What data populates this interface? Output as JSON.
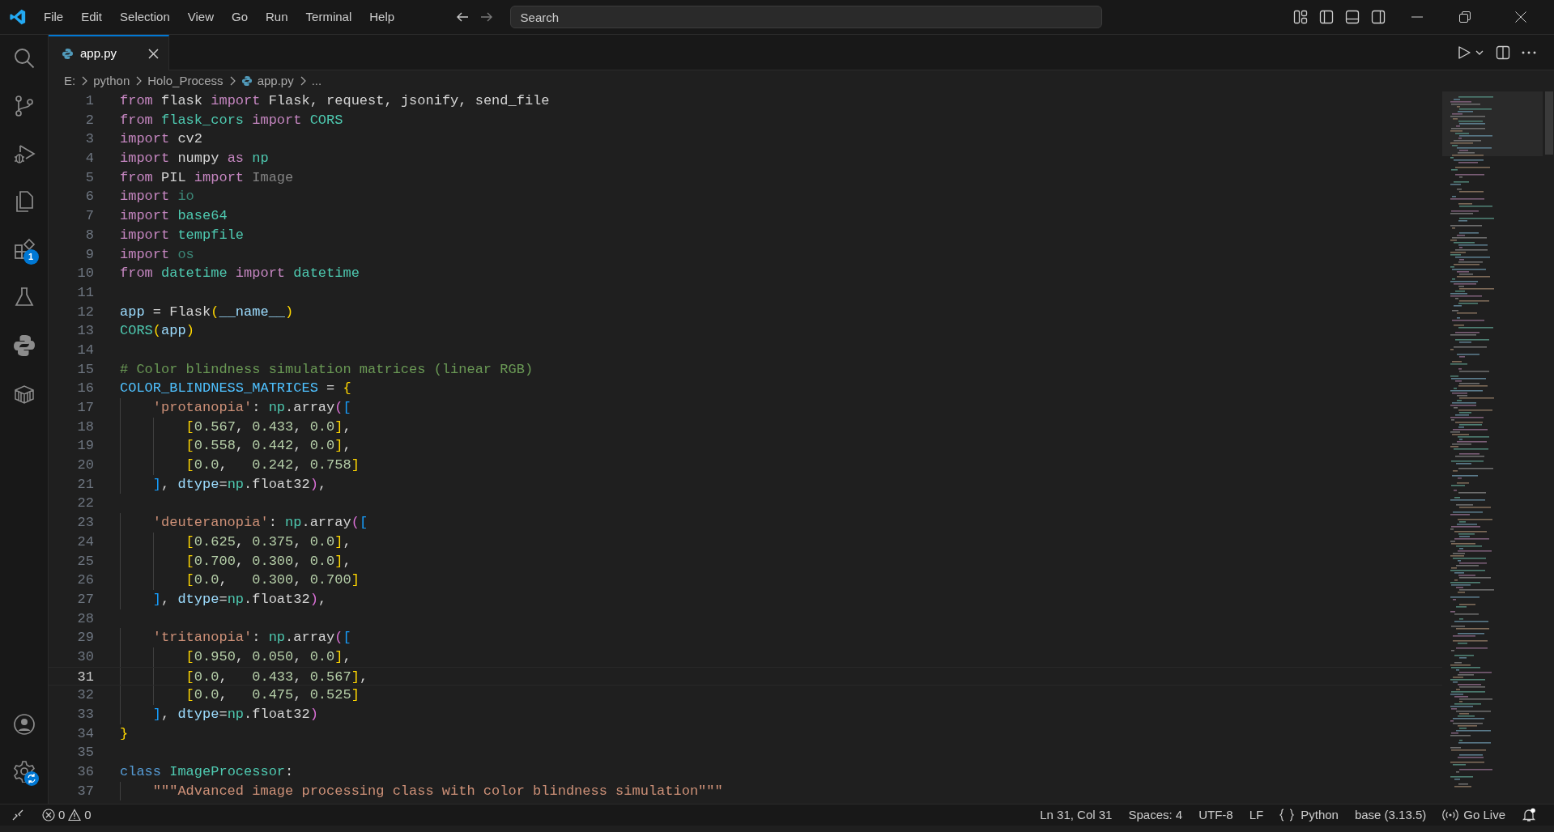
{
  "title_bar": {
    "menu": [
      "File",
      "Edit",
      "Selection",
      "View",
      "Go",
      "Run",
      "Terminal",
      "Help"
    ],
    "search": {
      "placeholder": "Search"
    }
  },
  "activity_bar": {
    "extensions_badge": "1"
  },
  "tabs": [
    {
      "label": "app.py",
      "selected": true
    }
  ],
  "breadcrumbs": [
    {
      "label": "E:",
      "kind": "folder"
    },
    {
      "label": "python",
      "kind": "folder"
    },
    {
      "label": "Holo_Process",
      "kind": "folder"
    },
    {
      "label": "app.py",
      "kind": "file"
    },
    {
      "label": "...",
      "kind": "more"
    }
  ],
  "editor": {
    "lines": [
      {
        "number": "1",
        "current": false,
        "tokens": [
          {
            "text": "from",
            "kind": "kw"
          },
          {
            "text": " flask ",
            "kind": "p"
          },
          {
            "text": "import",
            "kind": "kw"
          },
          {
            "text": " Flask, request, jsonify, send_file",
            "kind": "p"
          }
        ]
      },
      {
        "number": "2",
        "current": false,
        "tokens": [
          {
            "text": "from",
            "kind": "kw"
          },
          {
            "text": " flask_cors ",
            "kind": "mod"
          },
          {
            "text": "import",
            "kind": "kw"
          },
          {
            "text": " CORS",
            "kind": "mod"
          }
        ]
      },
      {
        "number": "3",
        "current": false,
        "tokens": [
          {
            "text": "import",
            "kind": "kw"
          },
          {
            "text": " cv2",
            "kind": "p"
          }
        ]
      },
      {
        "number": "4",
        "current": false,
        "tokens": [
          {
            "text": "import",
            "kind": "kw"
          },
          {
            "text": " numpy ",
            "kind": "p"
          },
          {
            "text": "as",
            "kind": "kw"
          },
          {
            "text": " np",
            "kind": "mod"
          }
        ]
      },
      {
        "number": "5",
        "current": false,
        "tokens": [
          {
            "text": "from",
            "kind": "kw"
          },
          {
            "text": " PIL ",
            "kind": "p"
          },
          {
            "text": "import",
            "kind": "kw"
          },
          {
            "text": " Image",
            "kind": "unused"
          }
        ]
      },
      {
        "number": "6",
        "current": false,
        "tokens": [
          {
            "text": "import",
            "kind": "kw"
          },
          {
            "text": " io",
            "kind": "unusedmod"
          }
        ]
      },
      {
        "number": "7",
        "current": false,
        "tokens": [
          {
            "text": "import",
            "kind": "kw"
          },
          {
            "text": " base64",
            "kind": "mod"
          }
        ]
      },
      {
        "number": "8",
        "current": false,
        "tokens": [
          {
            "text": "import",
            "kind": "kw"
          },
          {
            "text": " tempfile",
            "kind": "mod"
          }
        ]
      },
      {
        "number": "9",
        "current": false,
        "tokens": [
          {
            "text": "import",
            "kind": "kw"
          },
          {
            "text": " os",
            "kind": "unusedmod"
          }
        ]
      },
      {
        "number": "10",
        "current": false,
        "tokens": [
          {
            "text": "from",
            "kind": "kw"
          },
          {
            "text": " datetime ",
            "kind": "mod"
          },
          {
            "text": "import",
            "kind": "kw"
          },
          {
            "text": " datetime",
            "kind": "mod"
          }
        ]
      },
      {
        "number": "11",
        "current": false
      },
      {
        "number": "12",
        "current": false,
        "tokens": [
          {
            "text": "app",
            "kind": "var"
          },
          {
            "text": " = Flask",
            "kind": "p"
          },
          {
            "text": "(",
            "kind": "b1"
          },
          {
            "text": "__name__",
            "kind": "var"
          },
          {
            "text": ")",
            "kind": "b1"
          }
        ]
      },
      {
        "number": "13",
        "current": false,
        "tokens": [
          {
            "text": "CORS",
            "kind": "mod"
          },
          {
            "text": "(",
            "kind": "b1"
          },
          {
            "text": "app",
            "kind": "var"
          },
          {
            "text": ")",
            "kind": "b1"
          }
        ]
      },
      {
        "number": "14",
        "current": false
      },
      {
        "number": "15",
        "current": false,
        "tokens": [
          {
            "text": "# Color blindness simulation matrices (linear RGB)",
            "kind": "com"
          }
        ]
      },
      {
        "number": "16",
        "current": false,
        "tokens": [
          {
            "text": "COLOR_BLINDNESS_MATRICES",
            "kind": "const"
          },
          {
            "text": " = ",
            "kind": "p"
          },
          {
            "text": "{",
            "kind": "b1"
          }
        ]
      },
      {
        "number": "17",
        "current": false,
        "tokens": [
          {
            "text": "    'protanopia'",
            "kind": "str"
          },
          {
            "text": ": ",
            "kind": "p"
          },
          {
            "text": "np",
            "kind": "mod"
          },
          {
            "text": ".array",
            "kind": "p"
          },
          {
            "text": "(",
            "kind": "b2"
          },
          {
            "text": "[",
            "kind": "b3"
          }
        ]
      },
      {
        "number": "18",
        "current": false,
        "tokens": [
          {
            "text": "        [",
            "kind": "b1"
          },
          {
            "text": "0.567",
            "kind": "num"
          },
          {
            "text": ", ",
            "kind": "p"
          },
          {
            "text": "0.433",
            "kind": "num"
          },
          {
            "text": ", ",
            "kind": "p"
          },
          {
            "text": "0.0",
            "kind": "num"
          },
          {
            "text": "]",
            "kind": "b1"
          },
          {
            "text": ",",
            "kind": "p"
          }
        ]
      },
      {
        "number": "19",
        "current": false,
        "tokens": [
          {
            "text": "        [",
            "kind": "b1"
          },
          {
            "text": "0.558",
            "kind": "num"
          },
          {
            "text": ", ",
            "kind": "p"
          },
          {
            "text": "0.442",
            "kind": "num"
          },
          {
            "text": ", ",
            "kind": "p"
          },
          {
            "text": "0.0",
            "kind": "num"
          },
          {
            "text": "]",
            "kind": "b1"
          },
          {
            "text": ",",
            "kind": "p"
          }
        ]
      },
      {
        "number": "20",
        "current": false,
        "tokens": [
          {
            "text": "        [",
            "kind": "b1"
          },
          {
            "text": "0.0",
            "kind": "num"
          },
          {
            "text": ",   ",
            "kind": "p"
          },
          {
            "text": "0.242",
            "kind": "num"
          },
          {
            "text": ", ",
            "kind": "p"
          },
          {
            "text": "0.758",
            "kind": "num"
          },
          {
            "text": "]",
            "kind": "b1"
          }
        ]
      },
      {
        "number": "21",
        "current": false,
        "tokens": [
          {
            "text": "    ]",
            "kind": "b3"
          },
          {
            "text": ", ",
            "kind": "p"
          },
          {
            "text": "dtype",
            "kind": "var"
          },
          {
            "text": "=",
            "kind": "p"
          },
          {
            "text": "np",
            "kind": "mod"
          },
          {
            "text": ".float32",
            "kind": "p"
          },
          {
            "text": ")",
            "kind": "b2"
          },
          {
            "text": ",",
            "kind": "p"
          }
        ]
      },
      {
        "number": "22",
        "current": false
      },
      {
        "number": "23",
        "current": false,
        "tokens": [
          {
            "text": "    'deuteranopia'",
            "kind": "str"
          },
          {
            "text": ": ",
            "kind": "p"
          },
          {
            "text": "np",
            "kind": "mod"
          },
          {
            "text": ".array",
            "kind": "p"
          },
          {
            "text": "(",
            "kind": "b2"
          },
          {
            "text": "[",
            "kind": "b3"
          }
        ]
      },
      {
        "number": "24",
        "current": false,
        "tokens": [
          {
            "text": "        [",
            "kind": "b1"
          },
          {
            "text": "0.625",
            "kind": "num"
          },
          {
            "text": ", ",
            "kind": "p"
          },
          {
            "text": "0.375",
            "kind": "num"
          },
          {
            "text": ", ",
            "kind": "p"
          },
          {
            "text": "0.0",
            "kind": "num"
          },
          {
            "text": "]",
            "kind": "b1"
          },
          {
            "text": ",",
            "kind": "p"
          }
        ]
      },
      {
        "number": "25",
        "current": false,
        "tokens": [
          {
            "text": "        [",
            "kind": "b1"
          },
          {
            "text": "0.700",
            "kind": "num"
          },
          {
            "text": ", ",
            "kind": "p"
          },
          {
            "text": "0.300",
            "kind": "num"
          },
          {
            "text": ", ",
            "kind": "p"
          },
          {
            "text": "0.0",
            "kind": "num"
          },
          {
            "text": "]",
            "kind": "b1"
          },
          {
            "text": ",",
            "kind": "p"
          }
        ]
      },
      {
        "number": "26",
        "current": false,
        "tokens": [
          {
            "text": "        [",
            "kind": "b1"
          },
          {
            "text": "0.0",
            "kind": "num"
          },
          {
            "text": ",   ",
            "kind": "p"
          },
          {
            "text": "0.300",
            "kind": "num"
          },
          {
            "text": ", ",
            "kind": "p"
          },
          {
            "text": "0.700",
            "kind": "num"
          },
          {
            "text": "]",
            "kind": "b1"
          }
        ]
      },
      {
        "number": "27",
        "current": false,
        "tokens": [
          {
            "text": "    ]",
            "kind": "b3"
          },
          {
            "text": ", ",
            "kind": "p"
          },
          {
            "text": "dtype",
            "kind": "var"
          },
          {
            "text": "=",
            "kind": "p"
          },
          {
            "text": "np",
            "kind": "mod"
          },
          {
            "text": ".float32",
            "kind": "p"
          },
          {
            "text": ")",
            "kind": "b2"
          },
          {
            "text": ",",
            "kind": "p"
          }
        ]
      },
      {
        "number": "28",
        "current": false
      },
      {
        "number": "29",
        "current": false,
        "tokens": [
          {
            "text": "    'tritanopia'",
            "kind": "str"
          },
          {
            "text": ": ",
            "kind": "p"
          },
          {
            "text": "np",
            "kind": "mod"
          },
          {
            "text": ".array",
            "kind": "p"
          },
          {
            "text": "(",
            "kind": "b2"
          },
          {
            "text": "[",
            "kind": "b3"
          }
        ]
      },
      {
        "number": "30",
        "current": false,
        "tokens": [
          {
            "text": "        [",
            "kind": "b1"
          },
          {
            "text": "0.950",
            "kind": "num"
          },
          {
            "text": ", ",
            "kind": "p"
          },
          {
            "text": "0.050",
            "kind": "num"
          },
          {
            "text": ", ",
            "kind": "p"
          },
          {
            "text": "0.0",
            "kind": "num"
          },
          {
            "text": "]",
            "kind": "b1"
          },
          {
            "text": ",",
            "kind": "p"
          }
        ]
      },
      {
        "number": "31",
        "current": true,
        "tokens": [
          {
            "text": "        [",
            "kind": "b1"
          },
          {
            "text": "0.0",
            "kind": "num"
          },
          {
            "text": ",   ",
            "kind": "p"
          },
          {
            "text": "0.433",
            "kind": "num"
          },
          {
            "text": ", ",
            "kind": "p"
          },
          {
            "text": "0.567",
            "kind": "num"
          },
          {
            "text": "]",
            "kind": "b1"
          },
          {
            "text": ",",
            "kind": "p"
          }
        ]
      },
      {
        "number": "32",
        "current": false,
        "tokens": [
          {
            "text": "        [",
            "kind": "b1"
          },
          {
            "text": "0.0",
            "kind": "num"
          },
          {
            "text": ",   ",
            "kind": "p"
          },
          {
            "text": "0.475",
            "kind": "num"
          },
          {
            "text": ", ",
            "kind": "p"
          },
          {
            "text": "0.525",
            "kind": "num"
          },
          {
            "text": "]",
            "kind": "b1"
          }
        ]
      },
      {
        "number": "33",
        "current": false,
        "tokens": [
          {
            "text": "    ]",
            "kind": "b3"
          },
          {
            "text": ", ",
            "kind": "p"
          },
          {
            "text": "dtype",
            "kind": "var"
          },
          {
            "text": "=",
            "kind": "p"
          },
          {
            "text": "np",
            "kind": "mod"
          },
          {
            "text": ".float32",
            "kind": "p"
          },
          {
            "text": ")",
            "kind": "b2"
          }
        ]
      },
      {
        "number": "34",
        "current": false,
        "tokens": [
          {
            "text": "}",
            "kind": "b1"
          }
        ]
      },
      {
        "number": "35",
        "current": false
      },
      {
        "number": "36",
        "current": false,
        "tokens": [
          {
            "text": "class",
            "kind": "kw2"
          },
          {
            "text": " ImageProcessor",
            "kind": "mod"
          },
          {
            "text": ":",
            "kind": "p"
          }
        ]
      },
      {
        "number": "37",
        "current": false,
        "tokens": [
          {
            "text": "    \"\"\"Advanced image processing class with color blindness simulation\"\"\"",
            "kind": "str"
          }
        ]
      }
    ]
  },
  "status_bar": {
    "errors": "0",
    "warnings": "0",
    "cursor": "Ln 31, Col 31",
    "indent": "Spaces: 4",
    "encoding": "UTF-8",
    "eol": "LF",
    "language": "Python",
    "interpreter": "base (3.13.5)",
    "live": "Go Live"
  }
}
